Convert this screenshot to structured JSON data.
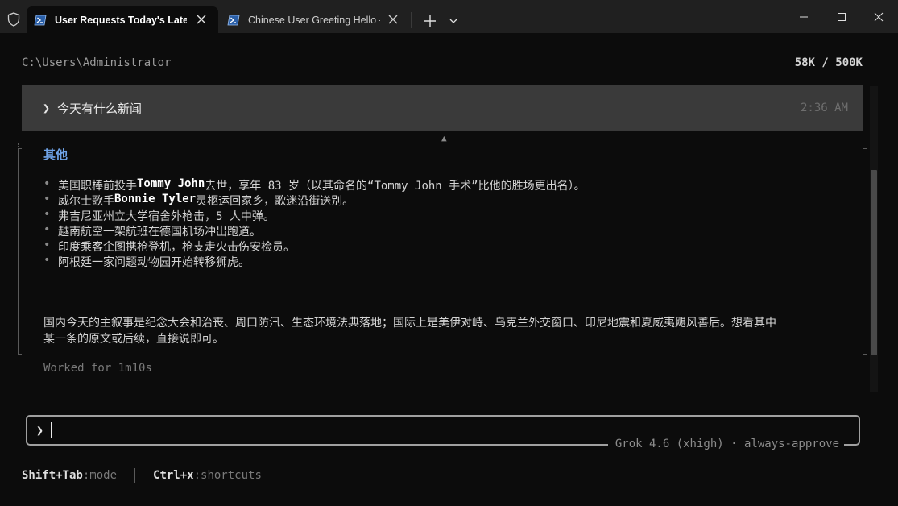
{
  "tabs": [
    {
      "title": "User Requests Today's Latest N",
      "active": true
    },
    {
      "title": "Chinese User Greeting Hello - g",
      "active": false
    }
  ],
  "icons": {
    "shield": "shield-icon",
    "tab": "powershell-icon",
    "close": "close-icon",
    "new_tab": "plus-icon",
    "dropdown": "chevron-down-icon",
    "minimize": "minimize-icon",
    "maximize": "maximize-icon",
    "window_close": "window-close-icon"
  },
  "colors": {
    "accent_heading": "#6fa3e8",
    "background": "#0c0c0c",
    "user_message_bg": "#3a3a3a"
  },
  "terminal": {
    "cwd": "C:\\Users\\Administrator",
    "tokens": "58K / 500K",
    "user_message": {
      "prompt": "❯",
      "text": "今天有什么新闻",
      "time": "2:36 AM"
    },
    "response": {
      "section_title": "其他",
      "bullets": [
        {
          "pre": "美国职棒前投手 ",
          "bold": "Tommy John",
          "post": " 去世，享年 83 岁（以其命名的“Tommy John 手术”比他的胜场更出名）。"
        },
        {
          "pre": "威尔士歌手 ",
          "bold": "Bonnie Tyler",
          "post": " 灵柩运回家乡，歌迷沿街送别。"
        },
        {
          "pre": "弗吉尼亚州立大学宿舍外枪击，5 人中弹。",
          "bold": "",
          "post": ""
        },
        {
          "pre": "越南航空一架航班在德国机场冲出跑道。",
          "bold": "",
          "post": ""
        },
        {
          "pre": "印度乘客企图携枪登机，枪支走火击伤安检员。",
          "bold": "",
          "post": ""
        },
        {
          "pre": "阿根廷一家问题动物园开始转移狮虎。",
          "bold": "",
          "post": ""
        }
      ],
      "bullet_char": "•",
      "summary": "国内今天的主叙事是纪念大会和治丧、周口防汛、生态环境法典落地；国际上是美伊对峙、乌克兰外交窗口、印尼地震和夏威夷飓风善后。想看其中某一条的原文或后续，直接说即可。"
    },
    "worked_for": "Worked for 1m10s"
  },
  "input": {
    "prompt": "❯",
    "value": "",
    "model_label": "Grok 4.6 (xhigh) · always-approve"
  },
  "footer": {
    "mode_key": "Shift+Tab",
    "mode_val": ":mode",
    "shortcuts_key": "Ctrl+x",
    "shortcuts_val": ":shortcuts"
  }
}
